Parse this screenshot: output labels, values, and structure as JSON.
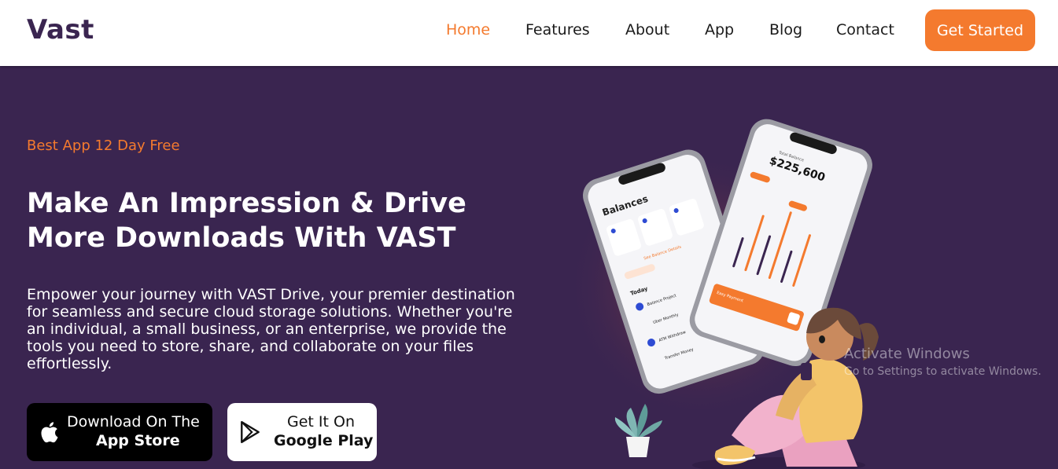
{
  "nav": {
    "logo": "Vast",
    "links": [
      {
        "label": "Home",
        "active": true
      },
      {
        "label": "Features",
        "active": false
      },
      {
        "label": "About",
        "active": false
      },
      {
        "label": "App",
        "active": false
      },
      {
        "label": "Blog",
        "active": false
      },
      {
        "label": "Contact",
        "active": false
      }
    ],
    "cta_label": "Get Started"
  },
  "hero": {
    "eyebrow": "Best App 12 Day Free",
    "headline": "Make An Impression & Drive More Downloads With VAST",
    "description": "Empower your journey with VAST Drive, your premier destination for seamless and secure cloud storage solutions. Whether you're an individual, a small business, or an enterprise, we provide the tools you need to store, share, and collaborate on your files effortlessly.",
    "buttons": {
      "app_store": {
        "line1": "Download On The",
        "line2": "App Store",
        "icon": "apple-icon"
      },
      "google_play": {
        "line1": "Get It On",
        "line2": "Google Play",
        "icon": "play-icon"
      }
    }
  },
  "phones": {
    "left": {
      "title": "Balances",
      "link": "See Balance Details",
      "section": "Today",
      "transactions": [
        "Balance Project",
        "Uber Monthly",
        "ATM Withdraw",
        "Transfer Money"
      ]
    },
    "right": {
      "label": "Total Balance",
      "amount": "$225,600",
      "card_label": "Easy Payment"
    }
  },
  "os_watermark": {
    "line1": "Activate Windows",
    "line2": "Go to Settings to activate Windows."
  },
  "colors": {
    "accent": "#f47a2e",
    "hero_bg": "#3a2550",
    "logo": "#3a2550"
  }
}
